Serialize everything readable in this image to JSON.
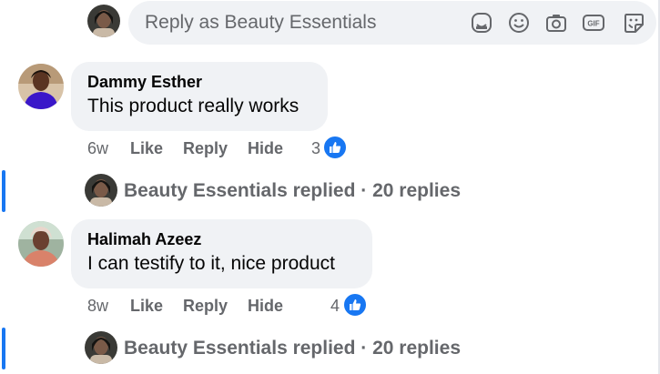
{
  "composer": {
    "placeholder": "Reply as Beauty Essentials",
    "tools": [
      "sticker-icon",
      "emoji-icon",
      "camera-icon",
      "gif-icon",
      "avatar-sticker-icon"
    ]
  },
  "comments": [
    {
      "author": "Dammy Esther",
      "text": "This product really works",
      "time": "6w",
      "like_label": "Like",
      "reply_label": "Reply",
      "hide_label": "Hide",
      "reaction_count": "3",
      "replies_summary": "Beauty Essentials replied · 20 replies"
    },
    {
      "author": "Halimah Azeez",
      "text": "I can testify to it, nice product",
      "time": "8w",
      "like_label": "Like",
      "reply_label": "Reply",
      "hide_label": "Hide",
      "reaction_count": "4",
      "replies_summary": "Beauty Essentials replied · 20 replies"
    }
  ],
  "colors": {
    "accent": "#1877f2",
    "bubble": "#f0f2f5",
    "secondary_text": "#65676b",
    "primary_text": "#050505"
  }
}
